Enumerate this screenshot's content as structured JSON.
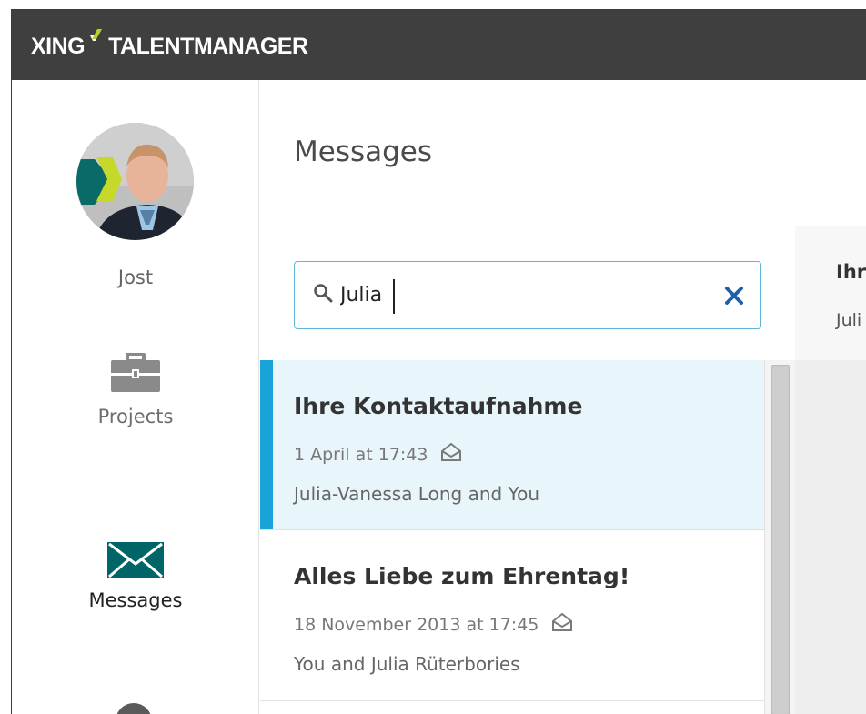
{
  "brand": {
    "left": "XING",
    "right": "TALENTMANAGER"
  },
  "colors": {
    "topbar": "#3f3f3f",
    "accent": "#1aa3d8",
    "logo_green": "#b7d12a",
    "messages_icon": "#006567",
    "active_row": "#e8f5fb",
    "search_border": "#5ab8dd",
    "clear_x": "#1d5fa8"
  },
  "profile": {
    "name": "Jost"
  },
  "nav": {
    "projects": {
      "label": "Projects",
      "icon": "briefcase-icon"
    },
    "messages": {
      "label": "Messages",
      "icon": "envelope-icon"
    }
  },
  "page": {
    "title": "Messages"
  },
  "search": {
    "value": "Julia",
    "icon": "search-icon",
    "clear_icon": "close-icon"
  },
  "conversations": [
    {
      "subject": "Ihre Kontaktaufnahme",
      "date": "1 April at 17:43",
      "participants": "Julia-Vanessa Long and You",
      "active": true,
      "status_icon": "open-envelope-icon"
    },
    {
      "subject": "Alles Liebe zum Ehrentag!",
      "date": "18 November 2013 at 17:45",
      "participants": "You and Julia Rüterbories",
      "active": false,
      "status_icon": "open-envelope-icon"
    }
  ],
  "detail": {
    "subject": "Ihr",
    "participants": "Juli"
  }
}
